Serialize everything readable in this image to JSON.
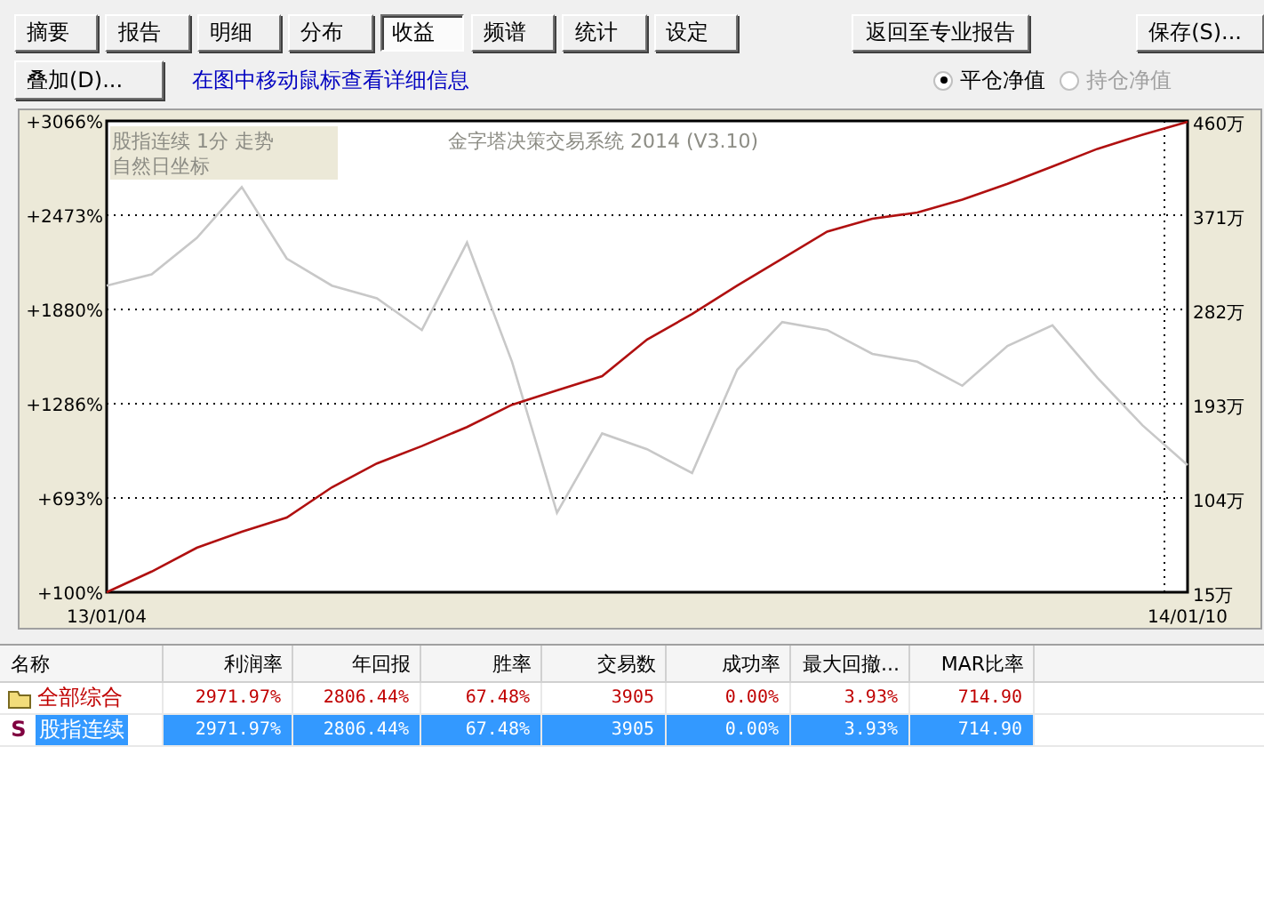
{
  "tabs": [
    {
      "label": "摘要",
      "selected": false
    },
    {
      "label": "报告",
      "selected": false
    },
    {
      "label": "明细",
      "selected": false
    },
    {
      "label": "分布",
      "selected": false
    },
    {
      "label": "收益",
      "selected": true
    },
    {
      "label": "频谱",
      "selected": false
    },
    {
      "label": "统计",
      "selected": false
    },
    {
      "label": "设定",
      "selected": false
    }
  ],
  "back_button": "返回至专业报告",
  "save_button": "保存(S)...",
  "overlay_button": "叠加(D)...",
  "hint": "在图中移动鼠标查看详细信息",
  "radios": [
    {
      "label": "平仓净值",
      "selected": true,
      "disabled": false
    },
    {
      "label": "持仓净值",
      "selected": false,
      "disabled": true
    }
  ],
  "chart": {
    "caption_lines": [
      "股指连续 1分 走势",
      "自然日坐标"
    ],
    "watermark": "金字塔决策交易系统 2014 (V3.10)",
    "right_axis": [
      "460万",
      "371万",
      "282万",
      "193万",
      "104万",
      "15万"
    ],
    "chart_data": {
      "type": "line",
      "grid": true,
      "categories": [
        "13/01/04",
        null,
        null,
        null,
        null,
        null,
        null,
        null,
        null,
        null,
        null,
        null,
        null,
        null,
        null,
        null,
        null,
        null,
        null,
        null,
        null,
        null,
        null,
        null,
        "14/01/10"
      ],
      "ylim": [
        100,
        3066
      ],
      "yticks": [
        {
          "value": 100,
          "label": "+100%"
        },
        {
          "value": 693,
          "label": "+693%"
        },
        {
          "value": 1286,
          "label": "+1286%"
        },
        {
          "value": 1880,
          "label": "+1880%"
        },
        {
          "value": 2473,
          "label": "+2473%"
        },
        {
          "value": 3066,
          "label": "+3066%"
        }
      ],
      "series": [
        {
          "color": "#c8c8c8",
          "values": [
            2030,
            2100,
            2330,
            2650,
            2200,
            2030,
            1950,
            1750,
            2300,
            1550,
            600,
            1100,
            1000,
            850,
            1500,
            1800,
            1750,
            1600,
            1550,
            1400,
            1650,
            1780,
            1450,
            1150,
            900
          ]
        },
        {
          "color": "#b01010",
          "values": [
            100,
            230,
            380,
            480,
            570,
            760,
            910,
            1020,
            1140,
            1280,
            1370,
            1460,
            1690,
            1850,
            2030,
            2200,
            2370,
            2450,
            2490,
            2570,
            2670,
            2780,
            2890,
            2980,
            3060
          ]
        }
      ]
    }
  },
  "table": {
    "columns": [
      "名称",
      "利润率",
      "年回报",
      "胜率",
      "交易数",
      "成功率",
      "最大回撤...",
      "MAR比率"
    ],
    "rows": [
      {
        "kind": "folder",
        "selected": false,
        "cells": [
          "全部综合",
          "2971.97%",
          "2806.44%",
          "67.48%",
          "3905",
          "0.00%",
          "3.93%",
          "714.90"
        ]
      },
      {
        "kind": "strategy",
        "icon_letter": "S",
        "selected": true,
        "cells": [
          "股指连续",
          "2971.97%",
          "2806.44%",
          "67.48%",
          "3905",
          "0.00%",
          "3.93%",
          "714.90"
        ]
      }
    ]
  }
}
